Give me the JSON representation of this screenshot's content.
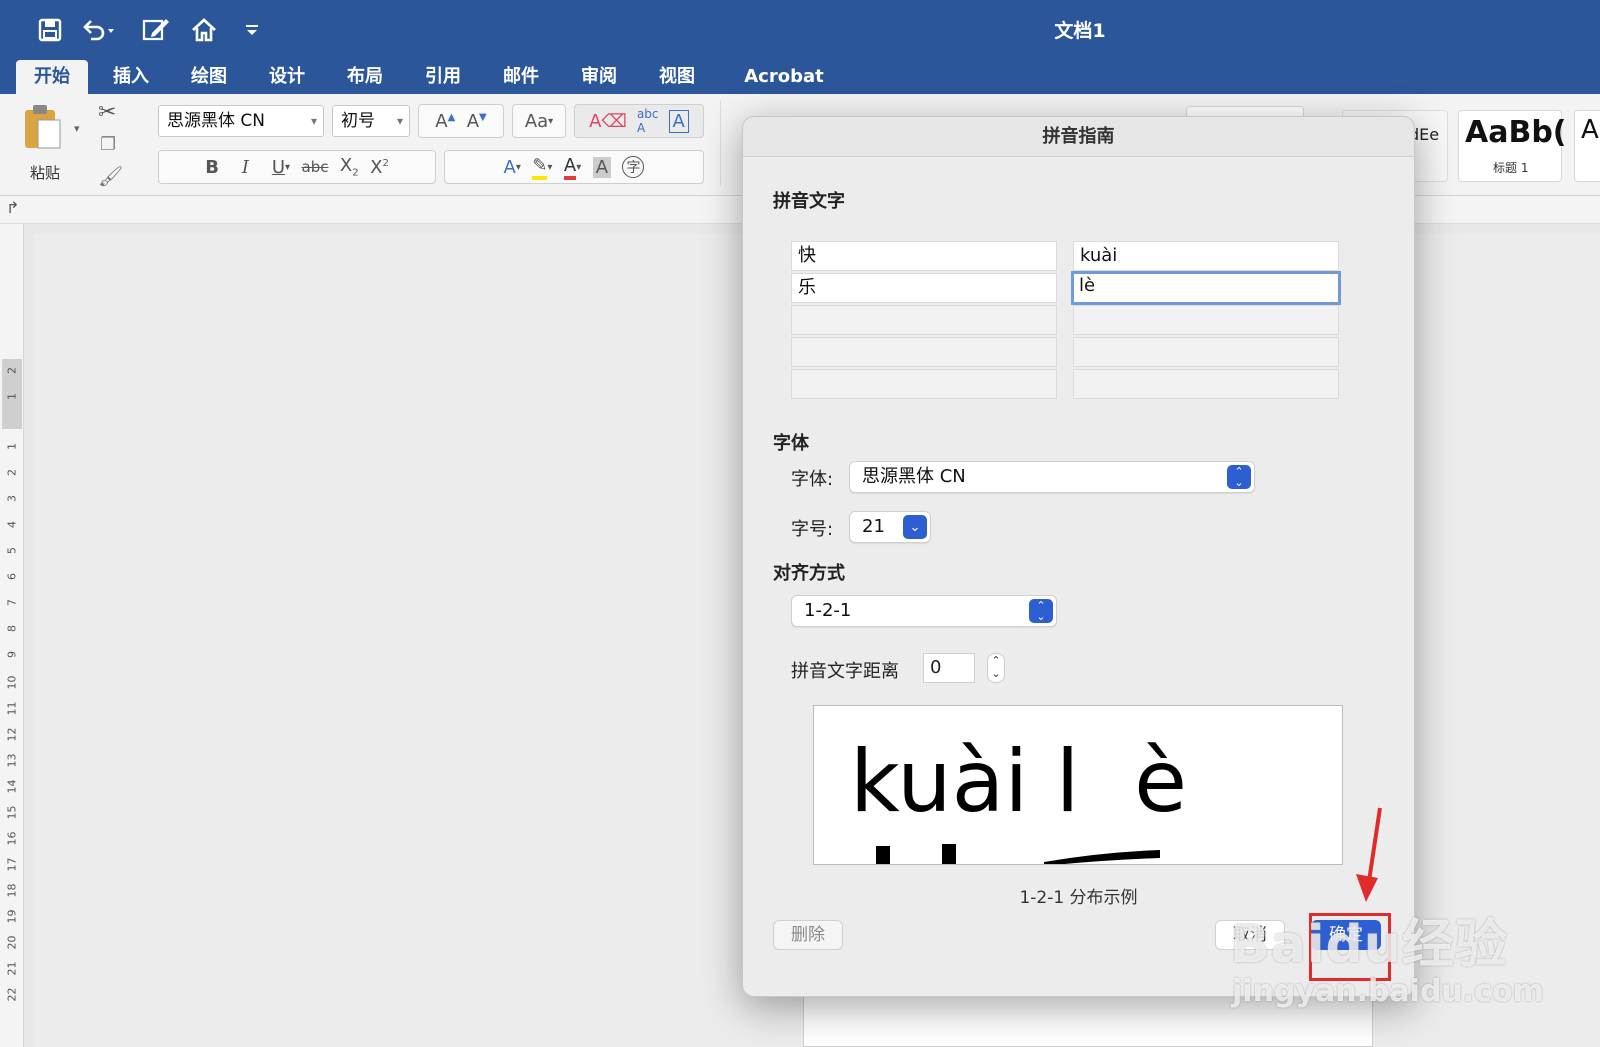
{
  "window": {
    "title": "文档1",
    "quick_access": [
      "save-icon",
      "undo-icon",
      "edit-doc-icon",
      "home-icon",
      "customize-icon"
    ]
  },
  "ribbon": {
    "tabs": [
      "开始",
      "插入",
      "绘图",
      "设计",
      "布局",
      "引用",
      "邮件",
      "审阅",
      "视图",
      "Acrobat"
    ],
    "active_tab": "开始",
    "paste_label": "粘贴",
    "font_name": "思源黑体 CN",
    "font_size": "初号",
    "style_partial": "dEe",
    "style_heading_sample": "AaBb(",
    "style_heading_label": "标题 1",
    "style_next_sample": "A"
  },
  "ruler": {
    "vertical_numbers": [
      "2",
      "1",
      "1",
      "2",
      "3",
      "4",
      "5",
      "6",
      "7",
      "8",
      "9",
      "10",
      "11",
      "12",
      "13",
      "14",
      "15",
      "16",
      "17",
      "18",
      "19",
      "20",
      "21",
      "22"
    ]
  },
  "dialog": {
    "title": "拼音指南",
    "section_text": "拼音文字",
    "rows": [
      {
        "base": "快",
        "ruby": "kuài"
      },
      {
        "base": "乐",
        "ruby": "lè"
      }
    ],
    "section_font": "字体",
    "font_label": "字体:",
    "font_value": "思源黑体 CN",
    "size_label": "字号:",
    "size_value": "21",
    "section_align": "对齐方式",
    "align_value": "1-2-1",
    "offset_label": "拼音文字距离",
    "offset_value": "0",
    "preview_text": "kuài l  è",
    "caption": "1-2-1 分布示例",
    "delete_label": "删除",
    "cancel_label": "取消",
    "ok_label": "确定"
  },
  "watermark": {
    "brand": "Baidu经验",
    "url": "jingyan.baidu.com"
  },
  "colors": {
    "title_blue": "#2b579a",
    "accent_blue": "#2d5fd3",
    "annotation_red": "#e02b2b"
  }
}
